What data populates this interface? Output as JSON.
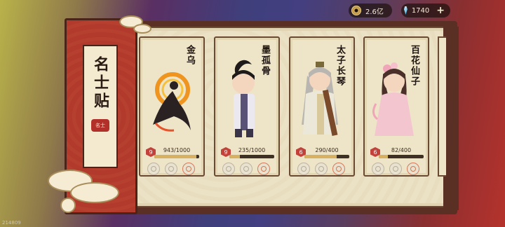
{
  "resources": {
    "coins": "2.6亿",
    "gems": "1740",
    "add_label": "+"
  },
  "book": {
    "title": "名士贴",
    "seal_text": "名士"
  },
  "cards": [
    {
      "name": "金乌",
      "level": "9",
      "progress_text": "943/1000",
      "progress": 0.943,
      "skills": [
        "locked",
        "locked",
        "active"
      ]
    },
    {
      "name": "墨孤骨",
      "level": "9",
      "progress_text": "235/1000",
      "progress": 0.235,
      "skills": [
        "locked",
        "locked",
        "active"
      ]
    },
    {
      "name": "太子长琴",
      "level": "6",
      "progress_text": "290/400",
      "progress": 0.725,
      "skills": [
        "locked",
        "locked",
        "active"
      ]
    },
    {
      "name": "百花仙子",
      "level": "6",
      "progress_text": "82/400",
      "progress": 0.205,
      "skills": [
        "locked",
        "locked",
        "active"
      ]
    }
  ],
  "watermark": "214809",
  "colors": {
    "accent": "#b23a2c",
    "paper": "#ebe1c4",
    "frame": "#6b4a34"
  }
}
